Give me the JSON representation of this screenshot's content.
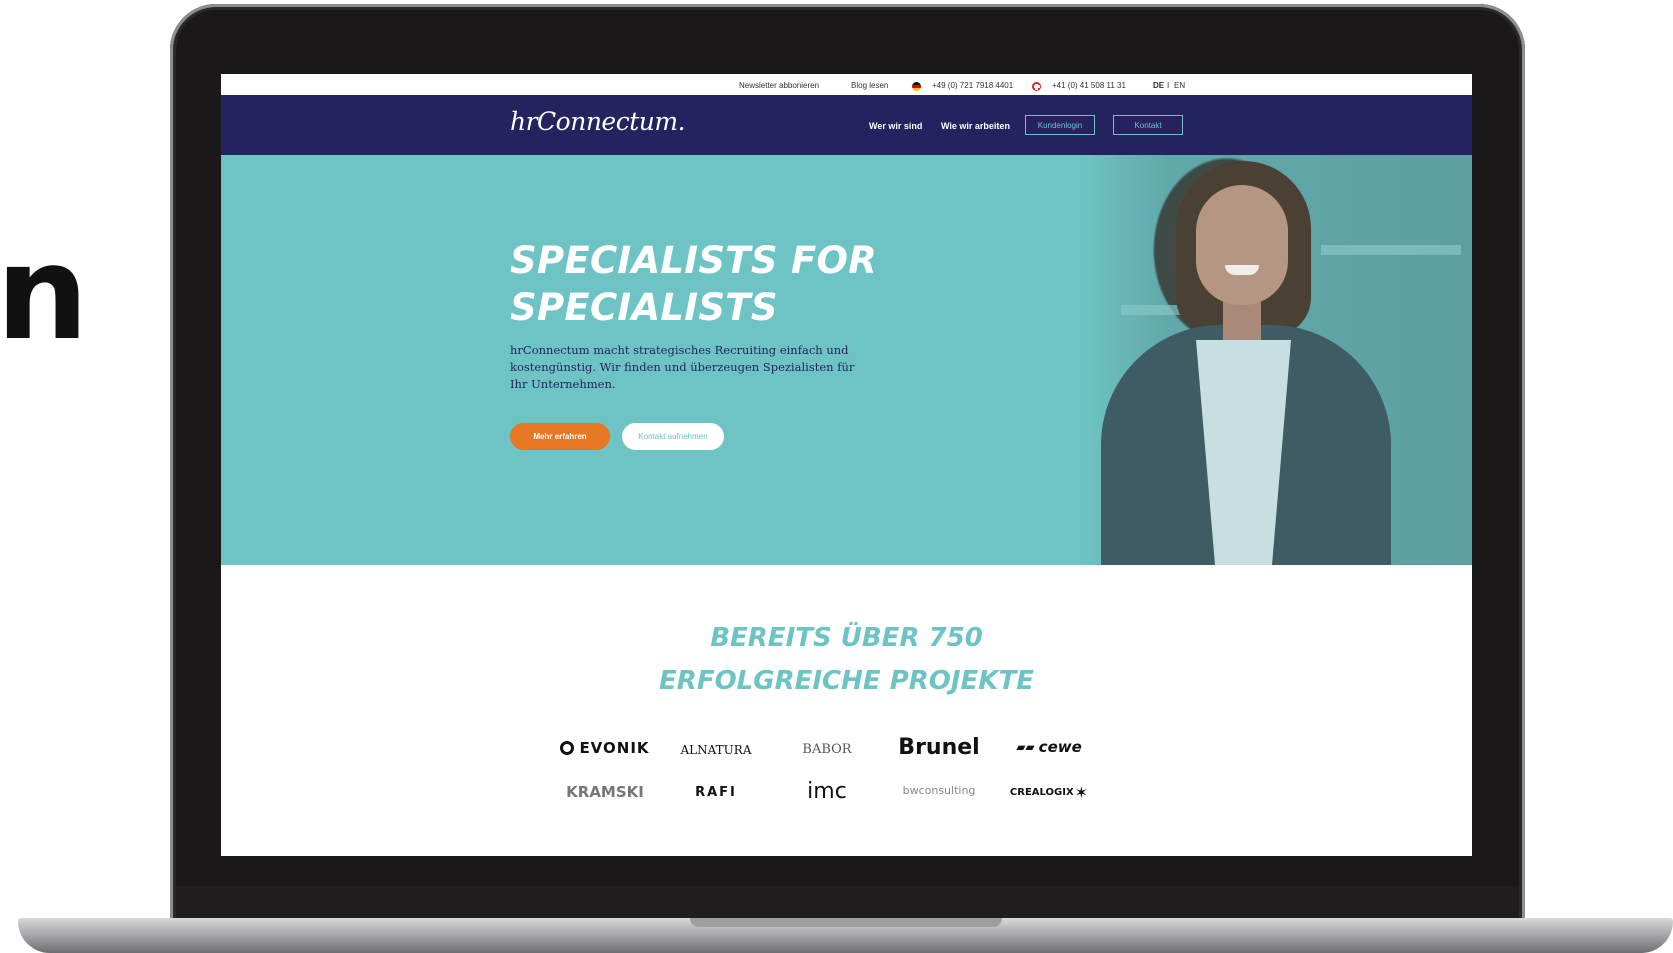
{
  "side_text": "n",
  "utility_bar": {
    "newsletter": "Newsletter abbonieren",
    "blog": "Blog lesen",
    "phone_de": "+49 (0) 721 7918 4401",
    "phone_ch": "+41 (0) 41 508 11 31",
    "lang_de": "DE",
    "lang_sep": "I",
    "lang_en": "EN"
  },
  "nav": {
    "logo": "hrConnectum.",
    "link_about": "Wer wir sind",
    "link_how": "Wie wir arbeiten",
    "btn_login": "Kundenlogin",
    "btn_contact": "Kontakt"
  },
  "hero": {
    "title_line1": "SPECIALISTS FOR",
    "title_line2": "SPECIALISTS",
    "text": "hrConnectum macht strategisches Recruiting einfach und kostengünstig. Wir finden und überzeugen Spezialisten für Ihr Unternehmen.",
    "btn_more": "Mehr erfahren",
    "btn_contact": "Kontakt aufnehmen"
  },
  "projects": {
    "title_line1": "BEREITS ÜBER 750",
    "title_line2": "ERFOLGREICHE PROJEKTE"
  },
  "client_logos": [
    "EVONIK",
    "ALNATURA",
    "BABOR",
    "Brunel",
    "cewe",
    "KRAMSKI",
    "RAFI",
    "imc",
    "bwconsulting",
    "CREALOGIX"
  ],
  "colors": {
    "navy": "#25235f",
    "teal": "#6ec4c4",
    "orange": "#e87723"
  }
}
